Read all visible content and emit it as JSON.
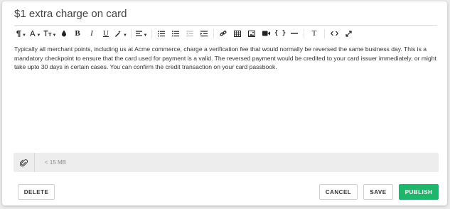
{
  "editor": {
    "title_value": "$1 extra charge on card",
    "body": "Typically all merchant points, including  us at Acme commerce, charge a verification fee that would normally be reversed the same business day. This is a mandatory checkpoint to ensure that the card used for payment is a valid. The reversed payment would be credited to your card issuer immediately, or might take upto 30 days in certain cases. You can confirm the credit transaction on your card passbook."
  },
  "toolbar": {
    "items": [
      "paragraph-format-icon",
      "font-family-icon",
      "font-size-icon",
      "text-color-icon",
      "bold-icon",
      "italic-icon",
      "underline-icon",
      "clear-format-icon",
      "align-icon",
      "ordered-list-icon",
      "unordered-list-icon",
      "outdent-icon",
      "indent-icon",
      "link-icon",
      "table-icon",
      "image-icon",
      "video-icon",
      "code-icon",
      "horizontal-rule-icon",
      "text-icon",
      "html-view-icon",
      "fullscreen-icon"
    ],
    "bold_label": "B",
    "italic_label": "I",
    "underline_label": "U",
    "text_label": "T",
    "code_label": "{ }"
  },
  "attachments": {
    "hint": "< 15 MB"
  },
  "actions": {
    "delete_label": "DELETE",
    "cancel_label": "CANCEL",
    "save_label": "SAVE",
    "publish_label": "PUBLISH"
  },
  "colors": {
    "accent": "#1fb56b",
    "attach_bar": "#ededed"
  }
}
